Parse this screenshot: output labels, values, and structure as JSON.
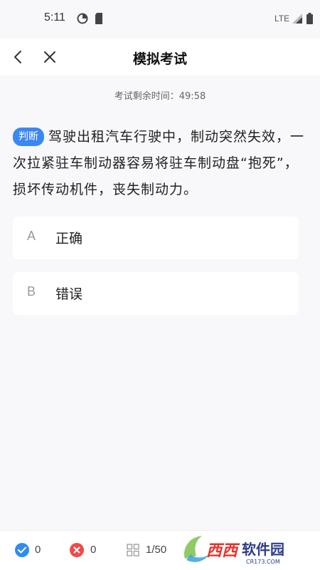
{
  "status_bar": {
    "time": "5:11",
    "network": "LTE"
  },
  "header": {
    "title": "模拟考试",
    "back_icon": "chevron-left-icon",
    "close_icon": "close-icon"
  },
  "timer": {
    "text": "考试剩余时间：49:58"
  },
  "question": {
    "type_badge": "判断",
    "text": "驾驶出租汽车行驶中，制动突然失效，一次拉紧驻车制动器容易将驻车制动盘“抱死”，损坏传动机件，丧失制动力。"
  },
  "options": [
    {
      "letter": "A",
      "text": "正确"
    },
    {
      "letter": "B",
      "text": "错误"
    }
  ],
  "bottom_bar": {
    "correct_count": "0",
    "wrong_count": "0",
    "progress": "1/50",
    "colors": {
      "correct": "#2f8cf0",
      "wrong": "#f04a4a"
    }
  },
  "watermark": {
    "brand": "西西软件园",
    "domain": "CR173.COM"
  }
}
